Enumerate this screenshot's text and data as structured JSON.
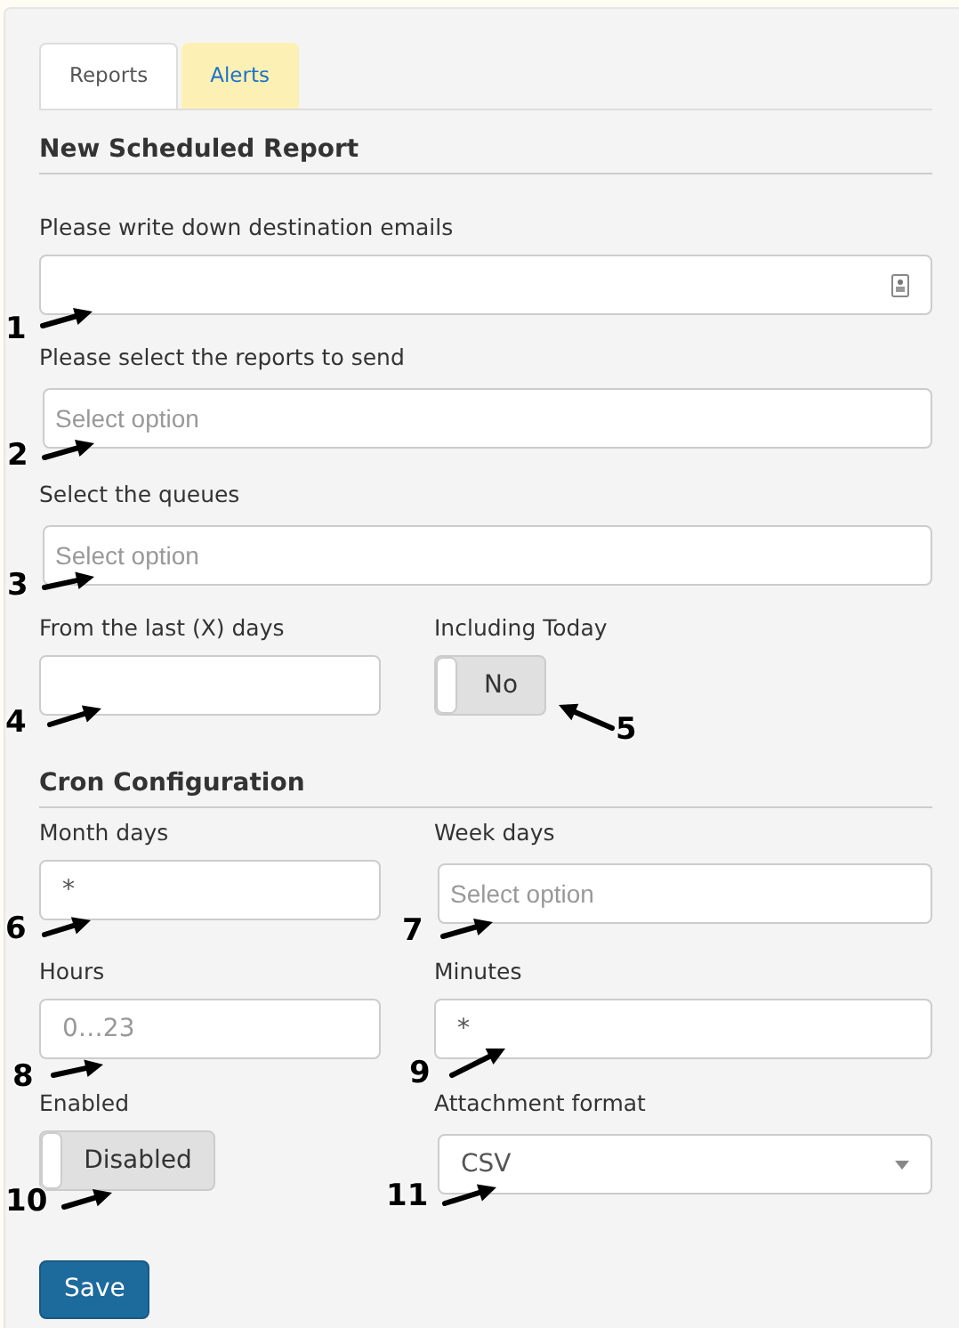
{
  "tabs": [
    {
      "label": "Reports",
      "selected": true
    },
    {
      "label": "Alerts",
      "selected": false
    }
  ],
  "report_section": {
    "heading": "New Scheduled Report",
    "emails": {
      "label": "Please write down destination emails"
    },
    "reports": {
      "label": "Please select the reports to send",
      "placeholder": "Select option"
    },
    "queues": {
      "label": "Select the queues",
      "placeholder": "Select option"
    },
    "last_days": {
      "label": "From the last (X) days"
    },
    "including_today": {
      "label": "Including Today",
      "on": false,
      "text": "No"
    }
  },
  "cron_section": {
    "heading": "Cron Configuration",
    "month_days": {
      "label": "Month days",
      "value": "*"
    },
    "week_days": {
      "label": "Week days",
      "placeholder": "Select option"
    },
    "hours": {
      "label": "Hours",
      "placeholder": "0…23"
    },
    "minutes": {
      "label": "Minutes",
      "value": "*"
    },
    "enabled": {
      "label": "Enabled",
      "on": false,
      "text": "Disabled"
    },
    "attachment_format": {
      "label": "Attachment format",
      "value": "CSV"
    }
  },
  "save_button": "Save",
  "callouts": [
    "1",
    "2",
    "3",
    "4",
    "5",
    "6",
    "7",
    "8",
    "9",
    "10",
    "11"
  ]
}
